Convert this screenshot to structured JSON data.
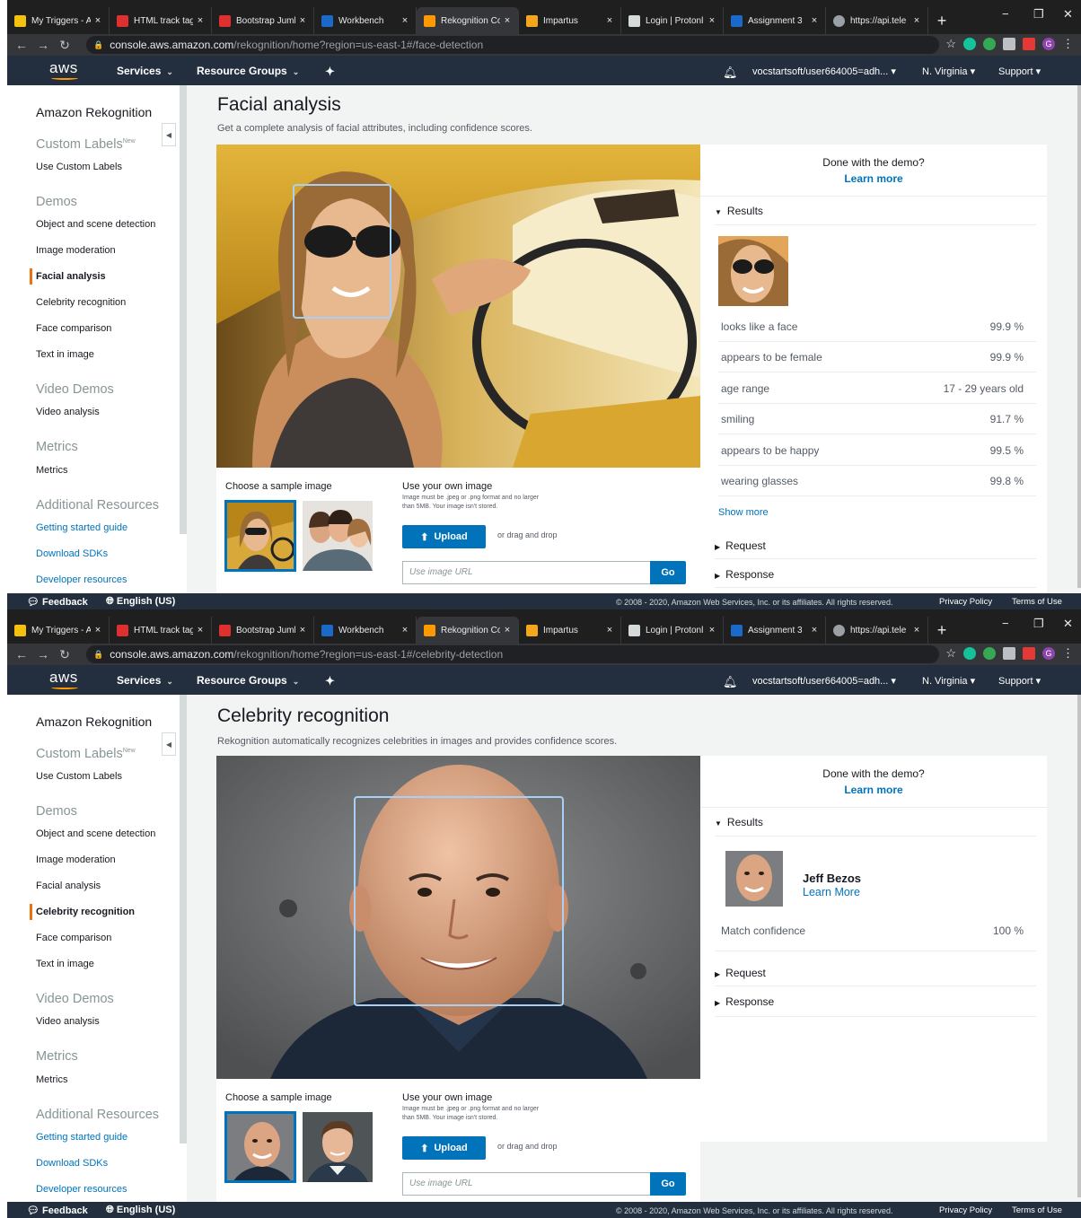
{
  "browser": {
    "tabs": [
      {
        "label": "My Triggers - A",
        "color": "#f4c20d"
      },
      {
        "label": "HTML track tag",
        "color": "#e02f2f"
      },
      {
        "label": "Bootstrap Jumb",
        "color": "#e02f2f"
      },
      {
        "label": "Workbench",
        "color": "#1b6ac9"
      },
      {
        "label": "Rekognition Co",
        "color": "#ff9900"
      },
      {
        "label": "Impartus",
        "color": "#f4a61d"
      },
      {
        "label": "Login | Protonl",
        "color": "#d5dbdb"
      },
      {
        "label": "Assignment 3",
        "color": "#1b6ac9"
      },
      {
        "label": "https://api.tele",
        "color": "#9aa0a6"
      }
    ],
    "close_glyph": "×",
    "new_tab": "+",
    "minimize": "−",
    "restore": "❐",
    "close": "✕",
    "url_host": "console.aws.amazon.com",
    "shot1_url_path": "/rekognition/home?region=us-east-1#/face-detection",
    "shot2_url_path": "/rekognition/home?region=us-east-1#/celebrity-detection",
    "profile_initial": "G"
  },
  "aws_nav": {
    "logo": "aws",
    "services": "Services",
    "resource_groups": "Resource Groups",
    "account": "vocstartsoft/user664005=adh...",
    "region": "N. Virginia",
    "support": "Support"
  },
  "sidebar": {
    "title": "Amazon Rekognition",
    "custom_labels_heading": "Custom Labels",
    "new_badge": "New",
    "use_custom_labels": "Use Custom Labels",
    "demos_heading": "Demos",
    "demos": [
      "Object and scene detection",
      "Image moderation",
      "Facial analysis",
      "Celebrity recognition",
      "Face comparison",
      "Text in image"
    ],
    "video_heading": "Video Demos",
    "video_analysis": "Video analysis",
    "metrics_heading": "Metrics",
    "metrics": "Metrics",
    "resources_heading": "Additional Resources",
    "resources": [
      "Getting started guide",
      "Download SDKs",
      "Developer resources"
    ]
  },
  "common": {
    "choose_sample": "Choose a sample image",
    "use_own": "Use your own image",
    "own_note": "Image must be .jpeg or .png format and no larger than 5MB. Your image isn't stored.",
    "upload": "Upload",
    "drag": "or drag and drop",
    "url_placeholder": "Use image URL",
    "go": "Go",
    "done_demo": "Done with the demo?",
    "learn_more": "Learn more",
    "results": "Results",
    "request": "Request",
    "response": "Response"
  },
  "facial": {
    "title": "Facial analysis",
    "description": "Get a complete analysis of facial attributes, including confidence scores.",
    "rows": [
      {
        "label": "looks like a face",
        "value": "99.9 %"
      },
      {
        "label": "appears to be female",
        "value": "99.9 %"
      },
      {
        "label": "age range",
        "value": "17 - 29 years old"
      },
      {
        "label": "smiling",
        "value": "91.7 %"
      },
      {
        "label": "appears to be happy",
        "value": "99.5 %"
      },
      {
        "label": "wearing glasses",
        "value": "99.8 %"
      }
    ],
    "show_more": "Show more"
  },
  "celebrity": {
    "title": "Celebrity recognition",
    "description": "Rekognition automatically recognizes celebrities in images and provides confidence scores.",
    "name": "Jeff Bezos",
    "learn_more": "Learn More",
    "match_label": "Match confidence",
    "match_value": "100 %"
  },
  "footer": {
    "feedback": "Feedback",
    "language": "English (US)",
    "copyright": "© 2008 - 2020, Amazon Web Services, Inc. or its affiliates. All rights reserved.",
    "privacy": "Privacy Policy",
    "terms": "Terms of Use"
  }
}
